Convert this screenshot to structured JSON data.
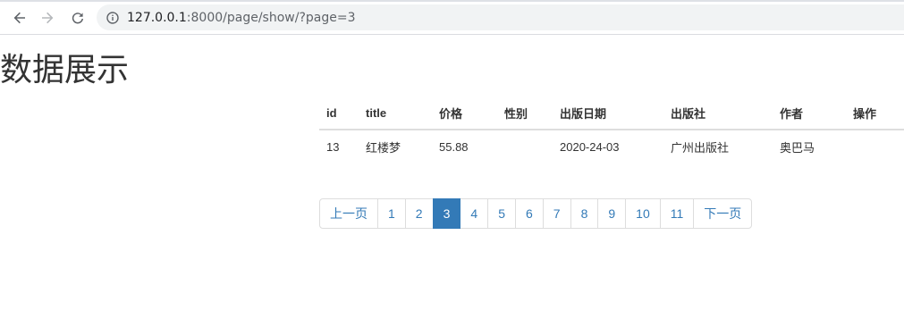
{
  "browser": {
    "url_host": "127.0.0.1",
    "url_rest": ":8000/page/show/?page=3",
    "icons": {
      "back": "arrow-left-icon",
      "forward": "arrow-right-icon",
      "reload": "reload-icon",
      "info": "info-icon"
    }
  },
  "page": {
    "title": "数据展示"
  },
  "table": {
    "headers": [
      "id",
      "title",
      "价格",
      "性别",
      "出版日期",
      "出版社",
      "作者",
      "操作"
    ],
    "rows": [
      [
        "13",
        "红楼梦",
        "55.88",
        "",
        "2020-24-03",
        "广州出版社",
        "奥巴马",
        ""
      ]
    ]
  },
  "pagination": {
    "prev": "上一页",
    "pages": [
      "1",
      "2",
      "3",
      "4",
      "5",
      "6",
      "7",
      "8",
      "9",
      "10",
      "11"
    ],
    "active": "3",
    "next": "下一页",
    "colors": {
      "link": "#337ab7",
      "active_bg": "#337ab7"
    }
  }
}
